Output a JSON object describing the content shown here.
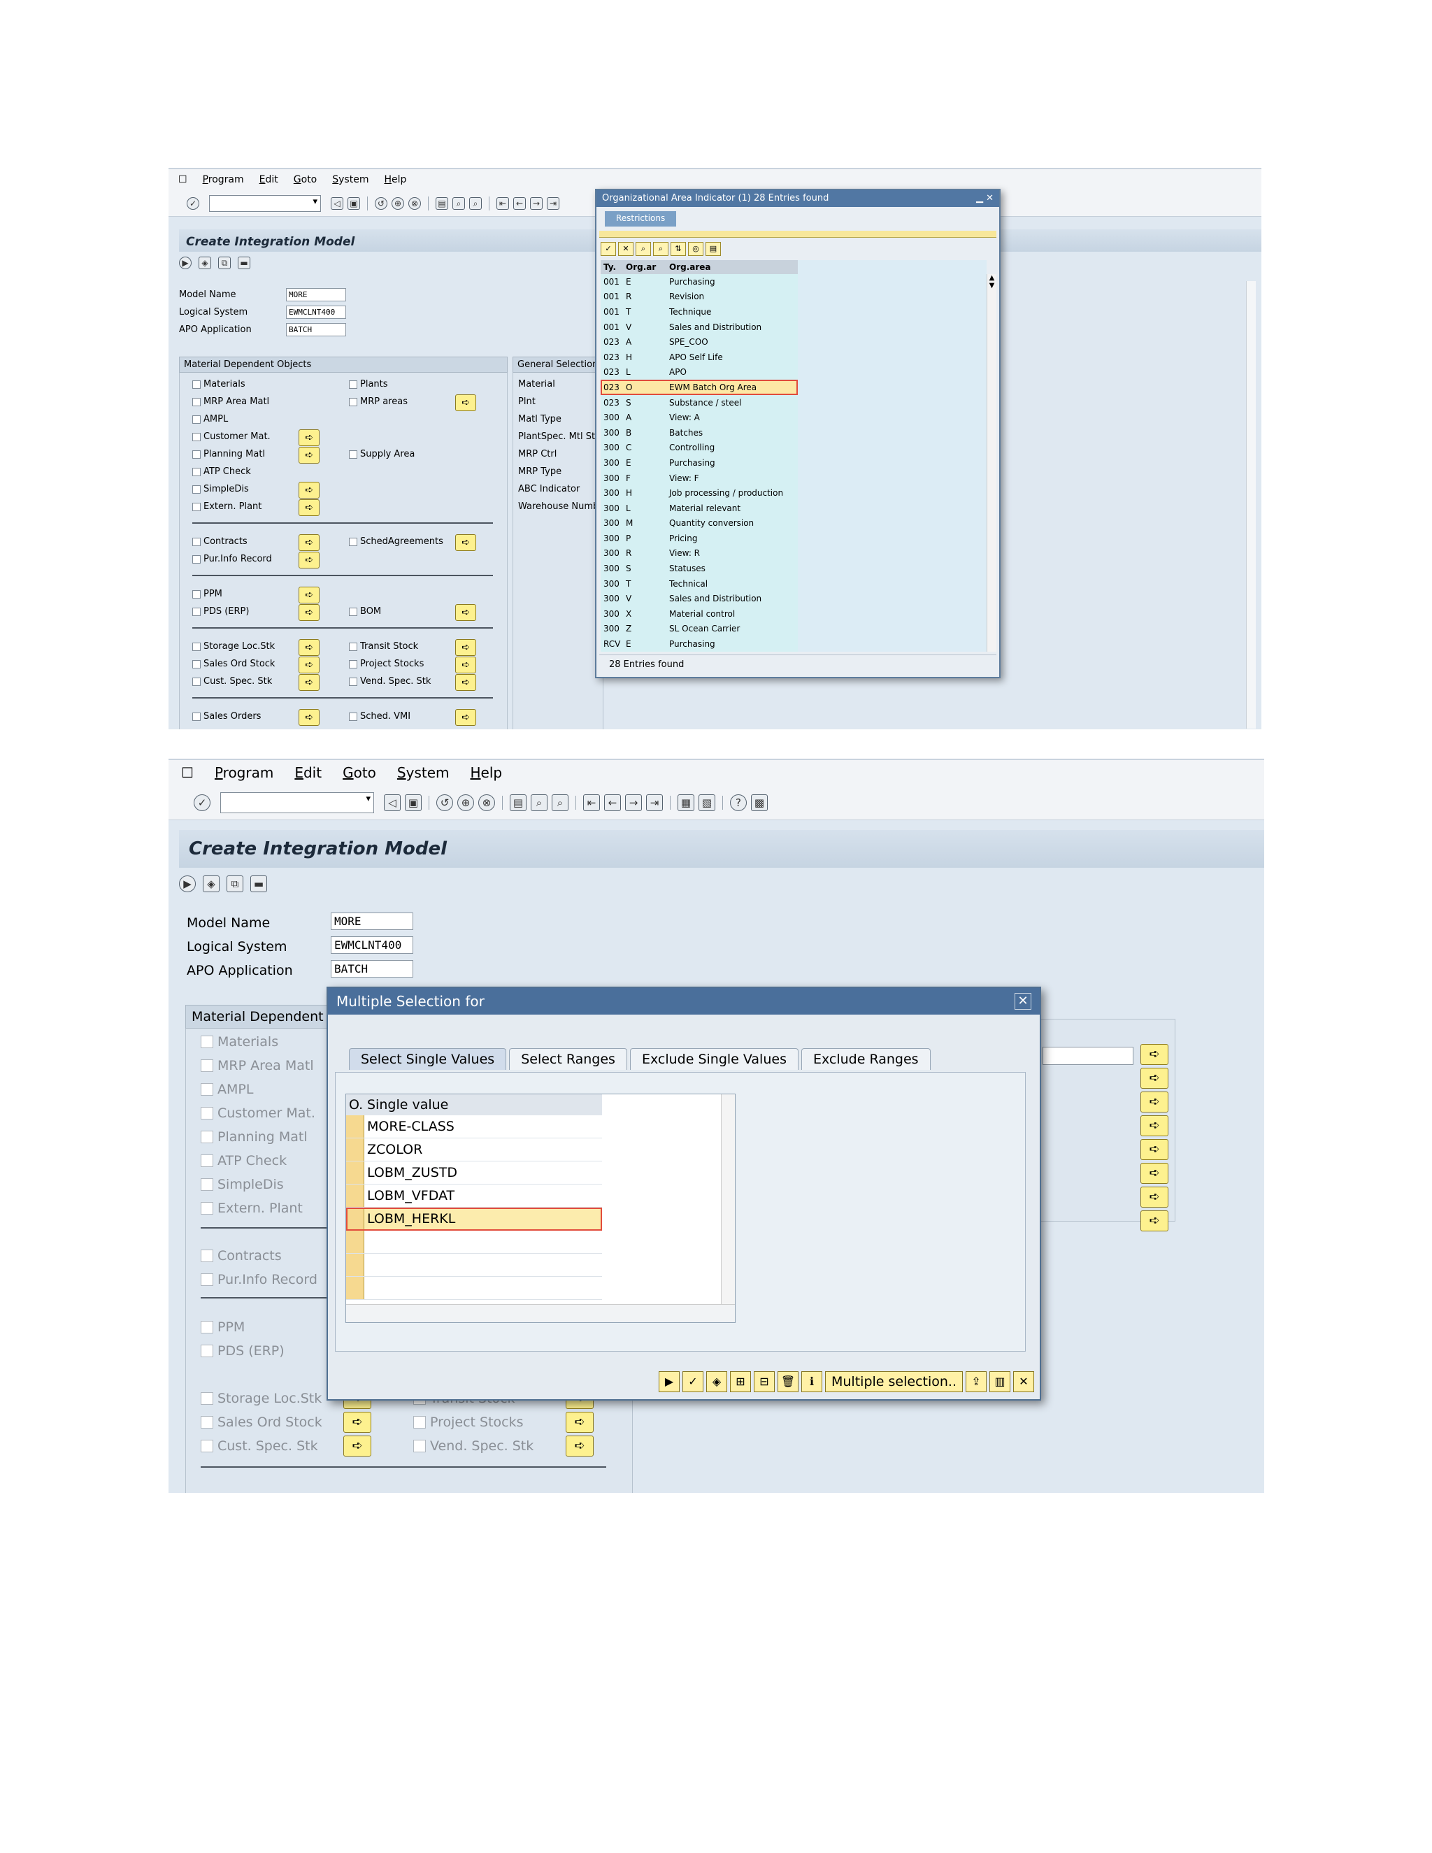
{
  "menu": [
    "Program",
    "Edit",
    "Goto",
    "System",
    "Help"
  ],
  "app": {
    "title": "Create Integration Model",
    "model_name_label": "Model Name",
    "model_name_value": "MORE",
    "logical_system_label": "Logical System",
    "logical_system_value": "EWMCLNT400",
    "apo_app_label": "APO Application",
    "apo_app_value": "BATCH"
  },
  "material_section": {
    "header": "Material Dependent Objects",
    "left": [
      "Materials",
      "MRP Area Matl",
      "AMPL",
      "Customer Mat.",
      "Planning Matl",
      "ATP Check",
      "SimpleDis",
      "Extern. Plant",
      "Contracts",
      "Pur.Info Record",
      "PPM",
      "PDS (ERP)",
      "Storage Loc.Stk",
      "Sales Ord Stock",
      "Cust. Spec. Stk",
      "Sales Orders"
    ],
    "right": [
      "Plants",
      "MRP areas",
      "Supply Area",
      "SchedAgreements",
      "BOM",
      "Transit Stock",
      "Project Stocks",
      "Vend. Spec. Stk",
      "Sched. VMI"
    ]
  },
  "general_section": {
    "header": "General Selection",
    "items": [
      "Material",
      "Plnt",
      "Matl Type",
      "PlantSpec. Mtl Sta",
      "MRP Ctrl",
      "MRP Type",
      "ABC Indicator",
      "Warehouse Numb"
    ]
  },
  "popup1": {
    "title": "Organizational Area Indicator (1)   28 Entries found",
    "tab": "Restrictions",
    "columns": [
      "Ty.",
      "Org.ar",
      "Org.area"
    ],
    "rows": [
      [
        "001",
        "E",
        "Purchasing"
      ],
      [
        "001",
        "R",
        "Revision"
      ],
      [
        "001",
        "T",
        "Technique"
      ],
      [
        "001",
        "V",
        "Sales and Distribution"
      ],
      [
        "023",
        "A",
        "SPE_COO"
      ],
      [
        "023",
        "H",
        "APO Self Life"
      ],
      [
        "023",
        "L",
        "APO"
      ],
      [
        "023",
        "O",
        "EWM Batch Org Area"
      ],
      [
        "023",
        "S",
        "Substance / steel"
      ],
      [
        "300",
        "A",
        "View: A"
      ],
      [
        "300",
        "B",
        "Batches"
      ],
      [
        "300",
        "C",
        "Controlling"
      ],
      [
        "300",
        "E",
        "Purchasing"
      ],
      [
        "300",
        "F",
        "View: F"
      ],
      [
        "300",
        "H",
        "Job processing / production"
      ],
      [
        "300",
        "L",
        "Material relevant"
      ],
      [
        "300",
        "M",
        "Quantity conversion"
      ],
      [
        "300",
        "P",
        "Pricing"
      ],
      [
        "300",
        "R",
        "View: R"
      ],
      [
        "300",
        "S",
        "Statuses"
      ],
      [
        "300",
        "T",
        "Technical"
      ],
      [
        "300",
        "V",
        "Sales and Distribution"
      ],
      [
        "300",
        "X",
        "Material control"
      ],
      [
        "300",
        "Z",
        "SL Ocean Carrier"
      ],
      [
        "RCV",
        "E",
        "Purchasing"
      ]
    ],
    "selected_index": 7,
    "status": "28 Entries found"
  },
  "popup2": {
    "title": "Multiple Selection for",
    "tabs": [
      "Select Single Values",
      "Select Ranges",
      "Exclude Single Values",
      "Exclude Ranges"
    ],
    "col_o": "O.",
    "col_value": "Single value",
    "values": [
      "MORE-CLASS",
      "ZCOLOR",
      "LOBM_ZUSTD",
      "LOBM_VFDAT",
      "LOBM_HERKL",
      "",
      "",
      ""
    ],
    "focus_index": 4,
    "multiple_selection_label": "Multiple selection.."
  }
}
